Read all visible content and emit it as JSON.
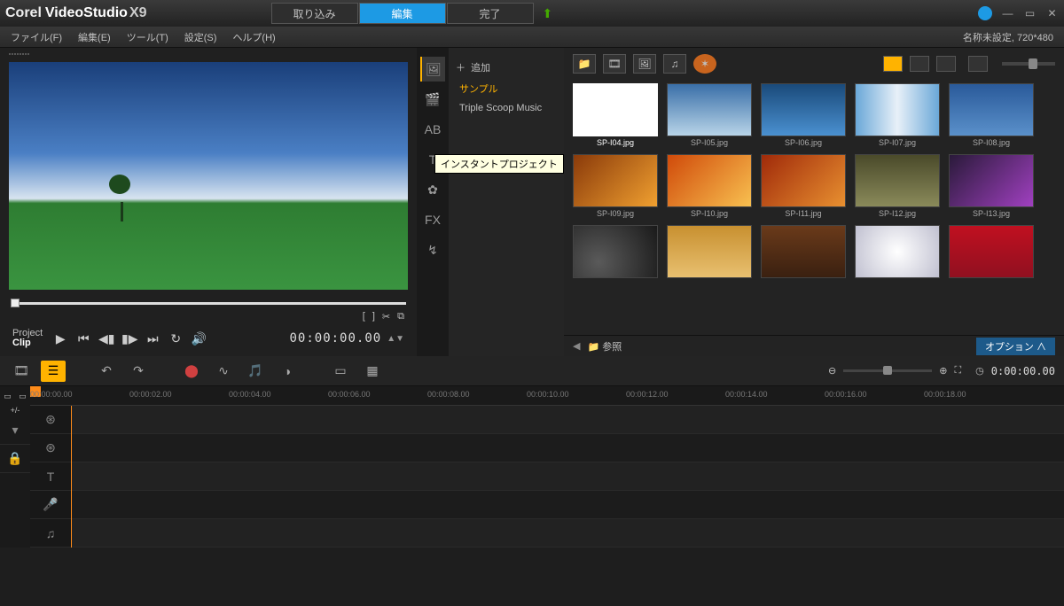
{
  "brand": {
    "corel": "Corel",
    "vs": "VideoStudio",
    "x9": "X9"
  },
  "topnav": {
    "capture": "取り込み",
    "edit": "編集",
    "share": "完了"
  },
  "menus": {
    "file": "ファイル(F)",
    "edit": "編集(E)",
    "tools": "ツール(T)",
    "settings": "設定(S)",
    "help": "ヘルプ(H)"
  },
  "status": "名称未設定, 720*480",
  "playback": {
    "project": "Project",
    "clip": "Clip",
    "timecode": "00:00:00.00"
  },
  "library": {
    "add": "追加",
    "tree": {
      "sample": "サンプル",
      "tsm": "Triple Scoop Music"
    },
    "tooltip": "インスタントプロジェクト",
    "browse": "参照",
    "options": "オプション ∧",
    "thumbs": [
      [
        "SP-I04.jpg",
        "SP-I05.jpg",
        "SP-I06.jpg",
        "SP-I07.jpg",
        "SP-I08.jpg"
      ],
      [
        "SP-I09.jpg",
        "SP-I10.jpg",
        "SP-I11.jpg",
        "SP-I12.jpg",
        "SP-I13.jpg"
      ],
      [
        "",
        "",
        "",
        "",
        ""
      ]
    ]
  },
  "timeline": {
    "timecode": "0:00:00.00",
    "ticks": [
      "00:00:00.00",
      "00:00:02.00",
      "00:00:04.00",
      "00:00:06.00",
      "00:00:08.00",
      "00:00:10.00",
      "00:00:12.00",
      "00:00:14.00",
      "00:00:16.00",
      "00:00:18.00"
    ]
  }
}
